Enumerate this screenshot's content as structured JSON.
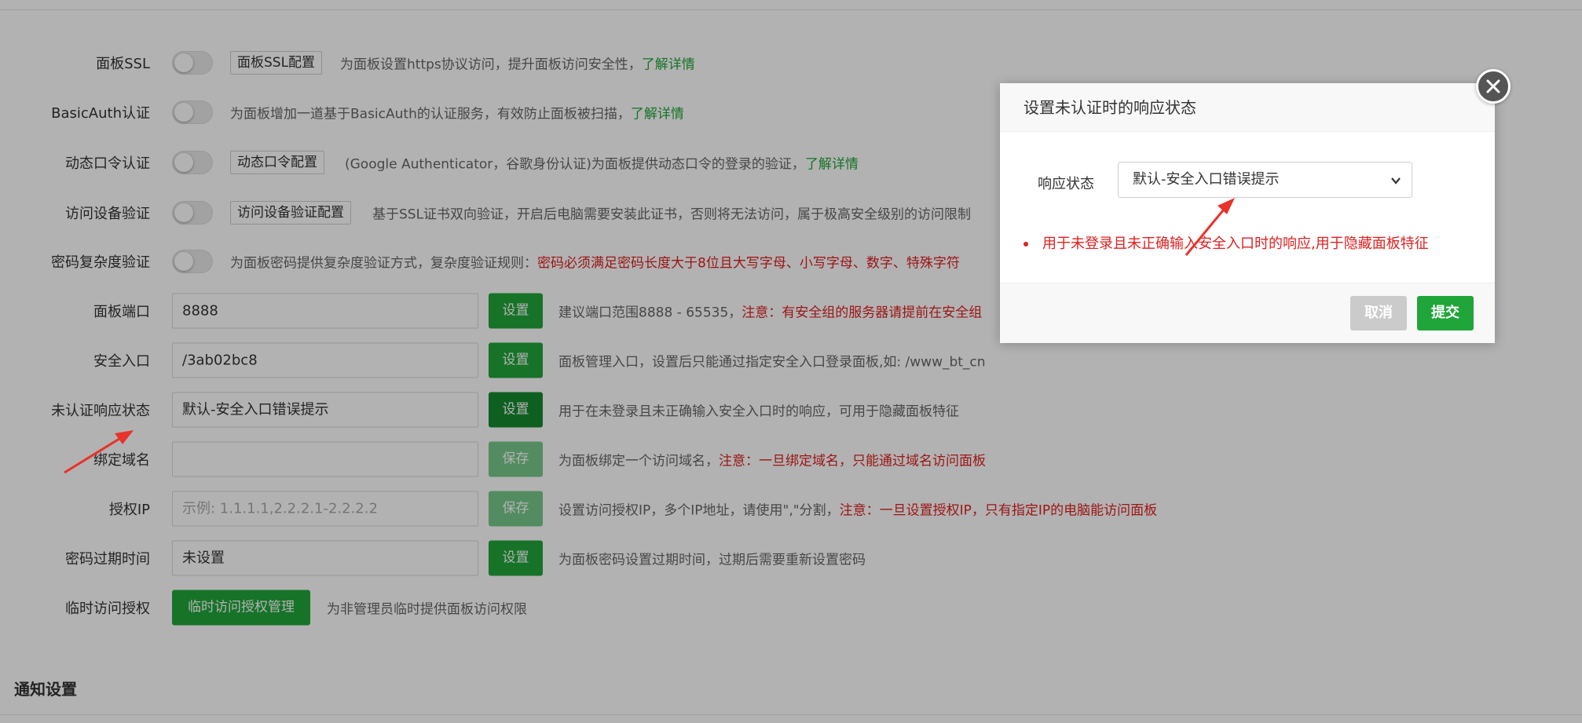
{
  "settings": {
    "ssl": {
      "label": "面板SSL",
      "config_button": "面板SSL配置",
      "desc": "为面板设置https协议访问，提升面板访问安全性，",
      "link": "了解详情"
    },
    "basic_auth": {
      "label": "BasicAuth认证",
      "desc": "为面板增加一道基于BasicAuth的认证服务，有效防止面板被扫描，",
      "link": "了解详情"
    },
    "dynamic_code": {
      "label": "动态口令认证",
      "config_button": "动态口令配置",
      "desc": "(Google Authenticator，谷歌身份认证)为面板提供动态口令的登录的验证，",
      "link": "了解详情"
    },
    "device_verify": {
      "label": "访问设备验证",
      "config_button": "访问设备验证配置",
      "desc": "基于SSL证书双向验证，开启后电脑需要安装此证书，否则将无法访问，属于极高安全级别的访问限制"
    },
    "password_complexity": {
      "label": "密码复杂度验证",
      "desc": "为面板密码提供复杂度验证方式，复杂度验证规则：",
      "desc_red": "密码必须满足密码长度大于8位且大写字母、小写字母、数字、特殊字符"
    },
    "panel_port": {
      "label": "面板端口",
      "value": "8888",
      "button": "设置",
      "desc": "建议端口范围8888 - 65535，",
      "desc_red": "注意：有安全组的服务器请提前在安全组"
    },
    "security_entry": {
      "label": "安全入口",
      "value": "/3ab02bc8",
      "button": "设置",
      "desc": "面板管理入口，设置后只能通过指定安全入口登录面板,如: /www_bt_cn"
    },
    "unauth_response": {
      "label": "未认证响应状态",
      "value": "默认-安全入口错误提示",
      "button": "设置",
      "desc": "用于在未登录且未正确输入安全入口时的响应，可用于隐藏面板特征"
    },
    "bind_domain": {
      "label": "绑定域名",
      "value": "",
      "button": "保存",
      "desc": "为面板绑定一个访问域名，",
      "desc_red": "注意：一旦绑定域名，只能通过域名访问面板"
    },
    "auth_ip": {
      "label": "授权IP",
      "placeholder": "示例: 1.1.1.1,2.2.2.1-2.2.2.2",
      "button": "保存",
      "desc": "设置访问授权IP，多个IP地址，请使用\",\"分割，",
      "desc_red": "注意：一旦设置授权IP，只有指定IP的电脑能访问面板"
    },
    "password_expire": {
      "label": "密码过期时间",
      "value": "未设置",
      "button": "设置",
      "desc": "为面板密码设置过期时间，过期后需要重新设置密码"
    },
    "temp_access": {
      "label": "临时访问授权",
      "button": "临时访问授权管理",
      "desc": "为非管理员临时提供面板访问权限"
    }
  },
  "section": {
    "notify_title": "通知设置"
  },
  "dialog": {
    "title": "设置未认证时的响应状态",
    "field_label": "响应状态",
    "selected": "默认-安全入口错误提示",
    "tip": "用于未登录且未正确输入安全入口时的响应,用于隐藏面板特征",
    "cancel": "取消",
    "submit": "提交"
  },
  "colors": {
    "accent_green": "#20a53a",
    "warning_red": "#e02020",
    "annotation_arrow": "#e8332a"
  },
  "icons": {
    "dialog_close": "close-icon",
    "select_toggle": "chevron-down-icon",
    "annotation": "red-arrow-icon"
  }
}
